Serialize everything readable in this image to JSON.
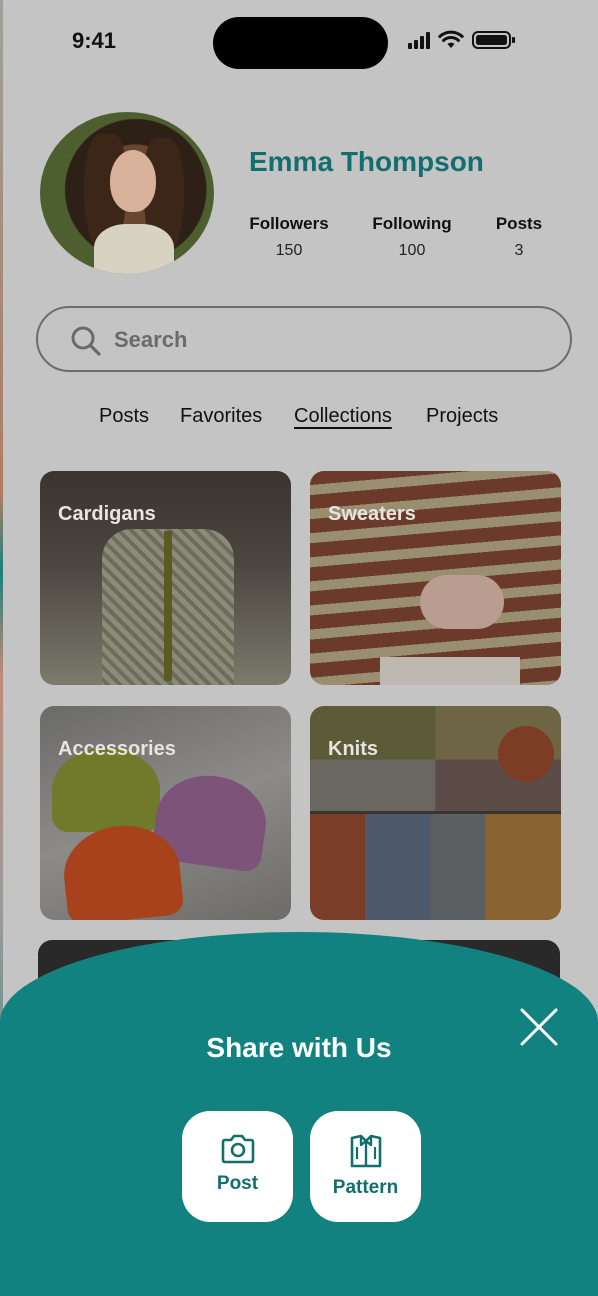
{
  "status_bar": {
    "time": "9:41"
  },
  "profile": {
    "name": "Emma Thompson",
    "stats": [
      {
        "label": "Followers",
        "value": "150"
      },
      {
        "label": "Following",
        "value": "100"
      },
      {
        "label": "Posts",
        "value": "3"
      }
    ]
  },
  "search": {
    "placeholder": "Search"
  },
  "tabs": {
    "items": [
      "Posts",
      "Favorites",
      "Collections",
      "Projects"
    ],
    "active": "Collections"
  },
  "collections": [
    {
      "label": "Cardigans"
    },
    {
      "label": "Sweaters"
    },
    {
      "label": "Accessories"
    },
    {
      "label": "Knits"
    }
  ],
  "share_sheet": {
    "title": "Share with Us",
    "buttons": [
      {
        "label": "Post",
        "icon": "camera-icon"
      },
      {
        "label": "Pattern",
        "icon": "pattern-shirt-icon"
      }
    ],
    "close_icon": "close-icon"
  },
  "colors": {
    "accent": "#128280",
    "name_text": "#136f6d",
    "overlay_background": "#c4c4c4"
  }
}
